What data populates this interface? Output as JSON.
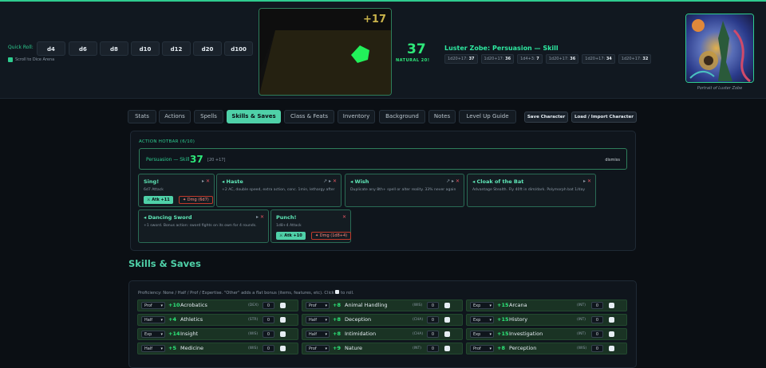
{
  "quick_roll": {
    "label": "Quick Roll:",
    "dice": [
      "d4",
      "d6",
      "d8",
      "d10",
      "d12",
      "d20",
      "d100"
    ],
    "scroll_label": "Scroll to Dice Arena"
  },
  "arena": {
    "modifier_display": "+17"
  },
  "last_roll": {
    "total": "37",
    "natural_label": "NATURAL 20!",
    "title": "Luster Zobe: Persuasion — Skill"
  },
  "history": [
    {
      "expr": "1d20+17:",
      "value": "37"
    },
    {
      "expr": "1d20+17:",
      "value": "36"
    },
    {
      "expr": "1d4+3:",
      "value": "7"
    },
    {
      "expr": "1d20+17:",
      "value": "36"
    },
    {
      "expr": "1d20+17:",
      "value": "34"
    },
    {
      "expr": "1d20+17:",
      "value": "32"
    }
  ],
  "portrait_caption": "Portrait of Luster Zobe",
  "tabs": [
    {
      "label": "Stats"
    },
    {
      "label": "Actions"
    },
    {
      "label": "Spells"
    },
    {
      "label": "Skills & Saves",
      "active": true
    },
    {
      "label": "Class & Feats"
    },
    {
      "label": "Inventory"
    },
    {
      "label": "Background"
    },
    {
      "label": "Notes"
    },
    {
      "label": "Level Up Guide"
    }
  ],
  "actions": {
    "save": "Save Character",
    "load": "Load / Import Character"
  },
  "hotbar": {
    "title": "ACTION HOTBAR (6/10)",
    "result": {
      "name": "Persuasion — Skill",
      "total": "37",
      "breakdown": "[20 +17]",
      "dismiss": "dismiss"
    },
    "cards": [
      {
        "name": "Sing!",
        "desc": "6d7 Attack",
        "atk": "Atk +11",
        "dmg": "Dmg (6d7)",
        "icons": "▸ ✕"
      },
      {
        "name": "◂ Haste",
        "desc": "+2 AC, double speed, extra action, conc. 1min, lethargy after",
        "icons": "↗ ▸ ✕"
      },
      {
        "name": "◂ Wish",
        "desc": "Duplicate any 8th+ spell or alter reality. 33% never again",
        "icons": "↗ ▸ ✕"
      },
      {
        "name": "◂ Cloak of the Bat",
        "desc": "Advantage Stealth. Fly 40ft in dim/dark. Polymorph bat 1/day",
        "icons": "▸ ✕"
      },
      {
        "name": "◂ Dancing Sword",
        "desc": "+1 sword. Bonus action: sword fights on its own for 4 rounds.",
        "icons": "▸ ✕"
      },
      {
        "name": "Punch!",
        "desc": "1d8+4 Attack",
        "atk": "Atk +10",
        "dmg": "Dmg (1d8+4)",
        "icons": "✕"
      }
    ]
  },
  "skills_section": {
    "title": "Skills & Saves",
    "note": "Proficiency: None / Half / Prof / Expertise. \"Other\" adds a flat bonus (items, features, etc). Click",
    "note_tail": "to roll.",
    "rows": [
      [
        {
          "prof": "Prof",
          "bonus": "+10",
          "name": "Acrobatics",
          "ability": "(DEX)",
          "other": "0"
        },
        {
          "prof": "Prof",
          "bonus": "+8",
          "name": "Animal Handling",
          "ability": "(WIS)",
          "other": "0"
        },
        {
          "prof": "Exp",
          "bonus": "+15",
          "name": "Arcana",
          "ability": "(INT)",
          "other": "0"
        }
      ],
      [
        {
          "prof": "Half",
          "bonus": "+4",
          "name": "Athletics",
          "ability": "(STR)",
          "other": "0"
        },
        {
          "prof": "Half",
          "bonus": "+8",
          "name": "Deception",
          "ability": "(CHA)",
          "other": "0"
        },
        {
          "prof": "Exp",
          "bonus": "+15",
          "name": "History",
          "ability": "(INT)",
          "other": "0"
        }
      ],
      [
        {
          "prof": "Exp",
          "bonus": "+14",
          "name": "Insight",
          "ability": "(WIS)",
          "other": "0"
        },
        {
          "prof": "Half",
          "bonus": "+8",
          "name": "Intimidation",
          "ability": "(CHA)",
          "other": "0"
        },
        {
          "prof": "Exp",
          "bonus": "+15",
          "name": "Investigation",
          "ability": "(INT)",
          "other": "0"
        }
      ],
      [
        {
          "prof": "Half",
          "bonus": "+5",
          "name": "Medicine",
          "ability": "(WIS)",
          "other": "0"
        },
        {
          "prof": "Prof",
          "bonus": "+9",
          "name": "Nature",
          "ability": "(INT)",
          "other": "0"
        },
        {
          "prof": "Prof",
          "bonus": "+8",
          "name": "Perception",
          "ability": "(WIS)",
          "other": "0"
        }
      ]
    ]
  }
}
